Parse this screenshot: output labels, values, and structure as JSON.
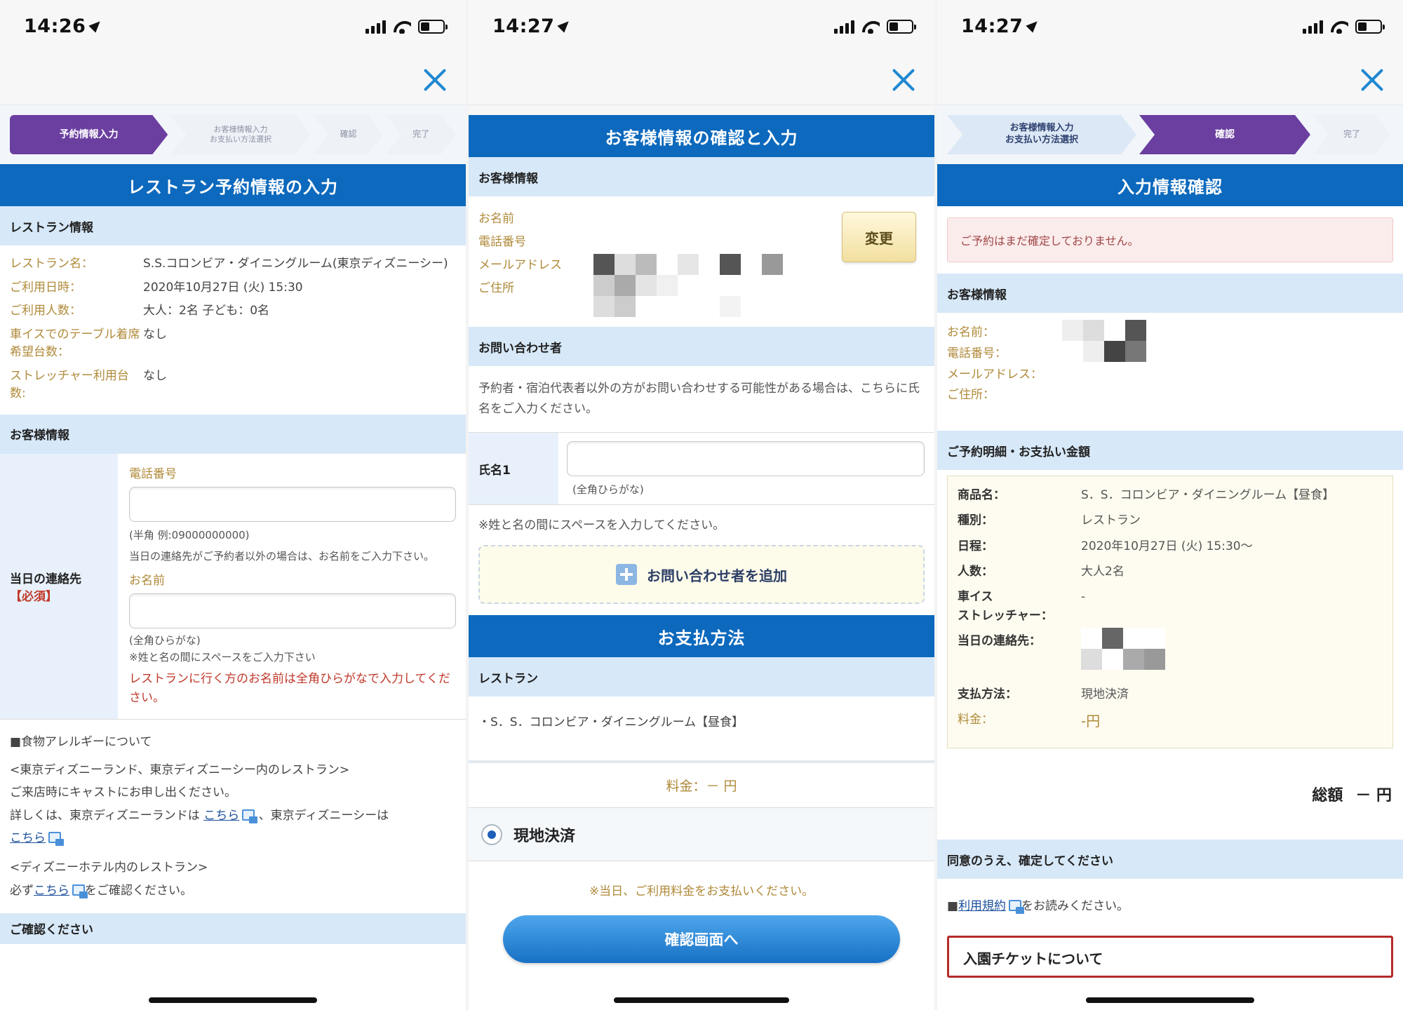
{
  "status_bar": [
    {
      "time": "14:26"
    },
    {
      "time": "14:27"
    },
    {
      "time": "14:27"
    }
  ],
  "panel1": {
    "steps": [
      "予約情報入力",
      "お客様情報入力\nお支払い方法選択",
      "確認",
      "完了"
    ],
    "title": "レストラン予約情報の入力",
    "restaurant_section": "レストラン情報",
    "restaurant_info": [
      {
        "label": "レストラン名：",
        "value": "S.S.コロンビア・ダイニングルーム(東京ディズニーシー)"
      },
      {
        "label": "ご利用日時：",
        "value": "2020年10月27日 (火) 15:30"
      },
      {
        "label": "ご利用人数：",
        "value": "大人：2名 子ども：0名"
      },
      {
        "label": "車イスでのテーブル着席希望台数：",
        "value": "なし"
      },
      {
        "label": "ストレッチャー利用台数:",
        "value": "なし"
      }
    ],
    "customer_section": "お客様情報",
    "contact": {
      "label": "当日の連絡先",
      "required": "【必須】",
      "phone_label": "電話番号",
      "phone_hint": "(半角 例:09000000000)",
      "other_hint": "当日の連絡先がご予約者以外の場合は、お名前をご入力下さい。",
      "name_label": "お名前",
      "name_hint1": "(全角ひらがな)",
      "name_hint2": "※姓と名の間にスペースをご入力下さい",
      "warning": "レストランに行く方のお名前は全角ひらがなで入力してください。"
    },
    "allergy": {
      "heading": "■食物アレルギーについて",
      "line1": "<東京ディズニーランド、東京ディズニーシー内のレストラン>",
      "line2": "ご来店時にキャストにお申し出ください。",
      "line3a": "詳しくは、東京ディズニーランドは",
      "link1": "こちら",
      "line3b": "、東京ディズニーシーは",
      "link2": "こちら",
      "line4": "<ディズニーホテル内のレストラン>",
      "line5a": "必ず",
      "link3": "こちら",
      "line5b": "をご確認ください。"
    },
    "bottom_section": "ご確認ください"
  },
  "panel2": {
    "title": "お客様情報の確認と入力",
    "customer_section": "お客様情報",
    "labels": [
      "お名前",
      "電話番号",
      "メールアドレス",
      "ご住所"
    ],
    "change_button": "変更",
    "inquiry_section": "お問い合わせ者",
    "inquiry_text": "予約者・宿泊代表者以外の方がお問い合わせする可能性がある場合は、こちらに氏名をご入力ください。",
    "name_label": "氏名1",
    "name_hint": "(全角ひらがな)",
    "space_note": "※姓と名の間にスペースを入力してください。",
    "add_button": "お問い合わせ者を追加",
    "payment_title": "お支払方法",
    "restaurant_section": "レストラン",
    "restaurant_line": "・S．S．コロンビア・ダイニングルーム【昼食】",
    "fee_line": "料金：－ 円",
    "payment_option": "現地決済",
    "payment_note": "※当日、ご利用料金をお支払いください。",
    "confirm_button": "確認画面へ"
  },
  "panel3": {
    "steps": [
      "お客様情報入力\nお支払い方法選択",
      "確認",
      "完了"
    ],
    "title": "入力情報確認",
    "alert": "ご予約はまだ確定しておりません。",
    "customer_section": "お客様情報",
    "labels": [
      "お名前：",
      "電話番号：",
      "メールアドレス：",
      "ご住所："
    ],
    "summary_section": "ご予約明細・お支払い金額",
    "summary": [
      {
        "label": "商品名：",
        "value": "S．S．コロンビア・ダイニングルーム【昼食】"
      },
      {
        "label": "種別：",
        "value": "レストラン"
      },
      {
        "label": "日程：",
        "value": "2020年10月27日 (火) 15:30～"
      },
      {
        "label": "人数：",
        "value": "大人2名"
      },
      {
        "label": "車イス\nストレッチャー：",
        "value": "-"
      },
      {
        "label": "当日の連絡先：",
        "value": ""
      },
      {
        "label": "支払方法：",
        "value": "現地決済"
      },
      {
        "label": "料金：",
        "value": "-円"
      }
    ],
    "total_label": "総額",
    "total_value": "－ 円",
    "agree_section": "同意のうえ、確定してください",
    "terms_prefix": "■",
    "terms_link": "利用規約",
    "terms_suffix": "をお読みください。",
    "ticket_box": "入園チケットについて"
  }
}
